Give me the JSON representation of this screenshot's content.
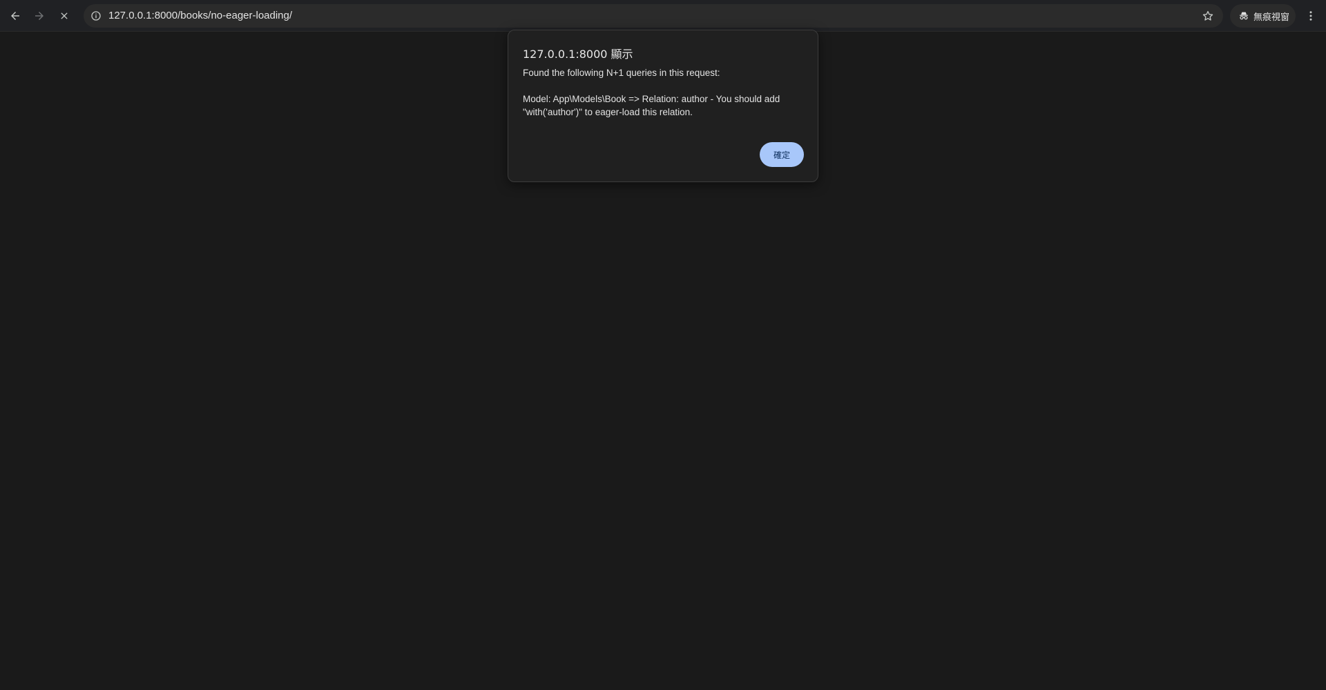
{
  "browser": {
    "url": "127.0.0.1:8000/books/no-eager-loading/",
    "incognito_label": "無痕視窗",
    "icons": {
      "back": "arrow-left-icon",
      "forward": "arrow-right-icon",
      "stop": "close-icon",
      "site_info": "info-icon",
      "bookmark": "star-icon",
      "incognito": "incognito-icon",
      "menu": "more-vert-icon"
    }
  },
  "dialog": {
    "title": "127.0.0.1:8000 顯示",
    "message": "Found the following N+1 queries in this request:\n\nModel: App\\Models\\Book => Relation: author - You should add \"with('author')\" to eager-load this relation.",
    "ok_label": "確定",
    "ok_color": "#a8c7fa"
  },
  "colors": {
    "page_background": "#1a1a1a",
    "toolbar_background": "#202124"
  }
}
